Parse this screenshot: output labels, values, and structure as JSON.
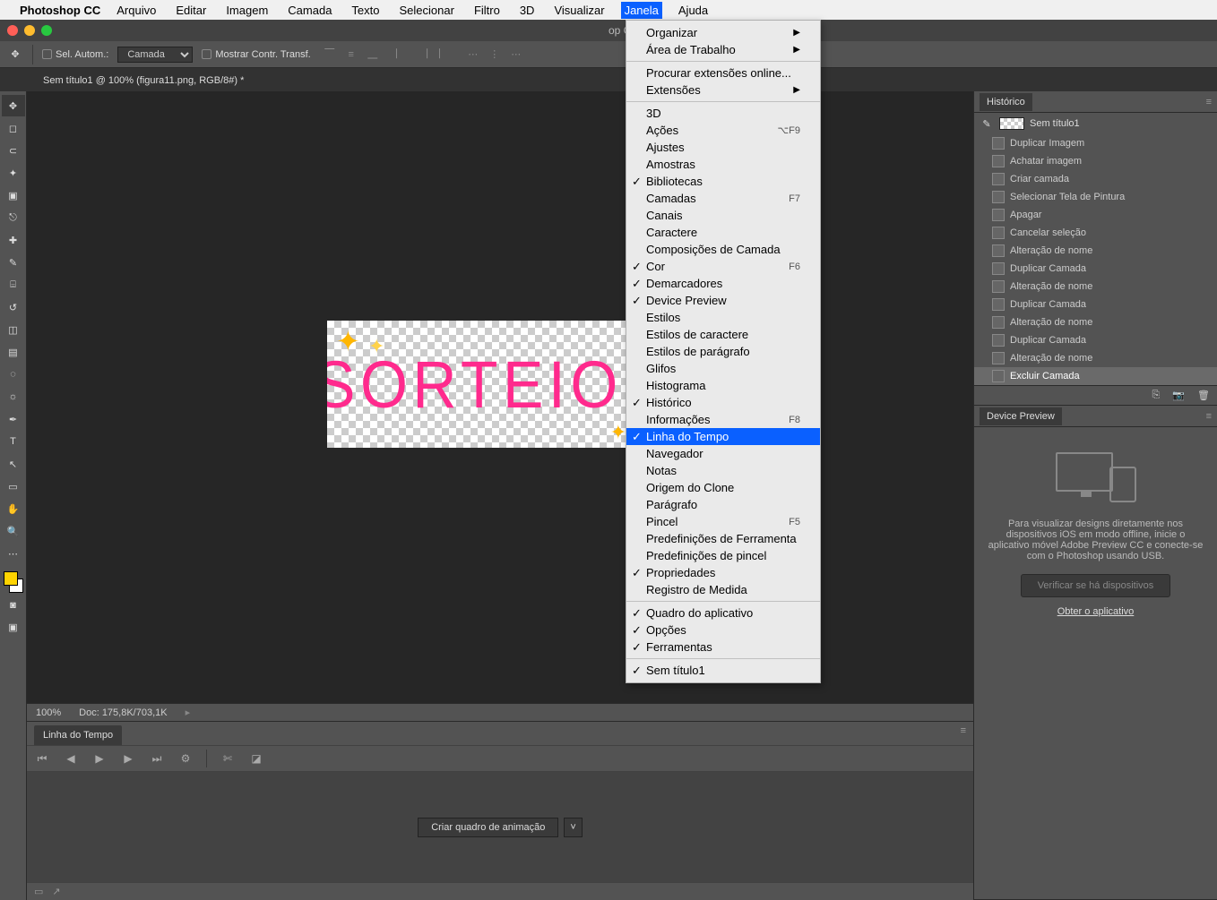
{
  "mac_menu": {
    "app": "Photoshop CC",
    "items": [
      "Arquivo",
      "Editar",
      "Imagem",
      "Camada",
      "Texto",
      "Selecionar",
      "Filtro",
      "3D",
      "Visualizar",
      "Janela",
      "Ajuda"
    ],
    "selected": "Janela"
  },
  "app_titlebar": {
    "title": "op CC 2017"
  },
  "options_bar": {
    "auto_select_label": "Sel. Autom.:",
    "auto_select_value": "Camada",
    "show_transform_label": "Mostrar Contr. Transf."
  },
  "document_tab": "Sem título1 @ 100% (figura11.png, RGB/8#) *",
  "canvas": {
    "headline": "SORTEIO!"
  },
  "status_bar": {
    "zoom": "100%",
    "doc_info": "Doc: 175,8K/703,1K"
  },
  "timeline": {
    "tab": "Linha do Tempo",
    "create_button": "Criar quadro de animação"
  },
  "history_panel": {
    "tab": "Histórico",
    "document": "Sem título1",
    "items": [
      "Duplicar Imagem",
      "Achatar imagem",
      "Criar camada",
      "Selecionar Tela de Pintura",
      "Apagar",
      "Cancelar seleção",
      "Alteração de nome",
      "Duplicar Camada",
      "Alteração de nome",
      "Duplicar Camada",
      "Alteração de nome",
      "Duplicar Camada",
      "Alteração de nome",
      "Excluir Camada"
    ],
    "active_index": 13
  },
  "device_preview": {
    "tab": "Device Preview",
    "text": "Para visualizar designs diretamente nos dispositivos iOS em modo offline, inicie o aplicativo móvel Adobe Preview CC e conecte-se com o Photoshop usando USB.",
    "button": "Verificar se há dispositivos",
    "link": "Obter o aplicativo"
  },
  "dropdown": {
    "items": [
      {
        "label": "Organizar",
        "submenu": true
      },
      {
        "label": "Área de Trabalho",
        "submenu": true
      },
      {
        "sep": true
      },
      {
        "label": "Procurar extensões online..."
      },
      {
        "label": "Extensões",
        "submenu": true
      },
      {
        "sep": true
      },
      {
        "label": "3D"
      },
      {
        "label": "Ações",
        "shortcut": "⌥F9"
      },
      {
        "label": "Ajustes"
      },
      {
        "label": "Amostras"
      },
      {
        "label": "Bibliotecas",
        "checked": true
      },
      {
        "label": "Camadas",
        "shortcut": "F7"
      },
      {
        "label": "Canais"
      },
      {
        "label": "Caractere"
      },
      {
        "label": "Composições de Camada"
      },
      {
        "label": "Cor",
        "shortcut": "F6",
        "checked": true
      },
      {
        "label": "Demarcadores",
        "checked": true
      },
      {
        "label": "Device Preview",
        "checked": true
      },
      {
        "label": "Estilos"
      },
      {
        "label": "Estilos de caractere"
      },
      {
        "label": "Estilos de parágrafo"
      },
      {
        "label": "Glifos"
      },
      {
        "label": "Histograma"
      },
      {
        "label": "Histórico",
        "checked": true
      },
      {
        "label": "Informações",
        "shortcut": "F8"
      },
      {
        "label": "Linha do Tempo",
        "checked": true,
        "highlight": true
      },
      {
        "label": "Navegador"
      },
      {
        "label": "Notas"
      },
      {
        "label": "Origem do Clone"
      },
      {
        "label": "Parágrafo"
      },
      {
        "label": "Pincel",
        "shortcut": "F5"
      },
      {
        "label": "Predefinições de Ferramenta"
      },
      {
        "label": "Predefinições de pincel"
      },
      {
        "label": "Propriedades",
        "checked": true
      },
      {
        "label": "Registro de Medida"
      },
      {
        "sep": true
      },
      {
        "label": "Quadro do aplicativo",
        "checked": true
      },
      {
        "label": "Opções",
        "checked": true
      },
      {
        "label": "Ferramentas",
        "checked": true
      },
      {
        "sep": true
      },
      {
        "label": "Sem título1",
        "checked": true
      }
    ]
  },
  "tools": [
    "move",
    "marquee",
    "lasso",
    "magic-wand",
    "crop",
    "eyedropper",
    "healing",
    "brush",
    "stamp",
    "history-brush",
    "eraser",
    "gradient",
    "blur",
    "dodge",
    "pen",
    "type",
    "path-select",
    "rectangle",
    "hand",
    "zoom"
  ]
}
